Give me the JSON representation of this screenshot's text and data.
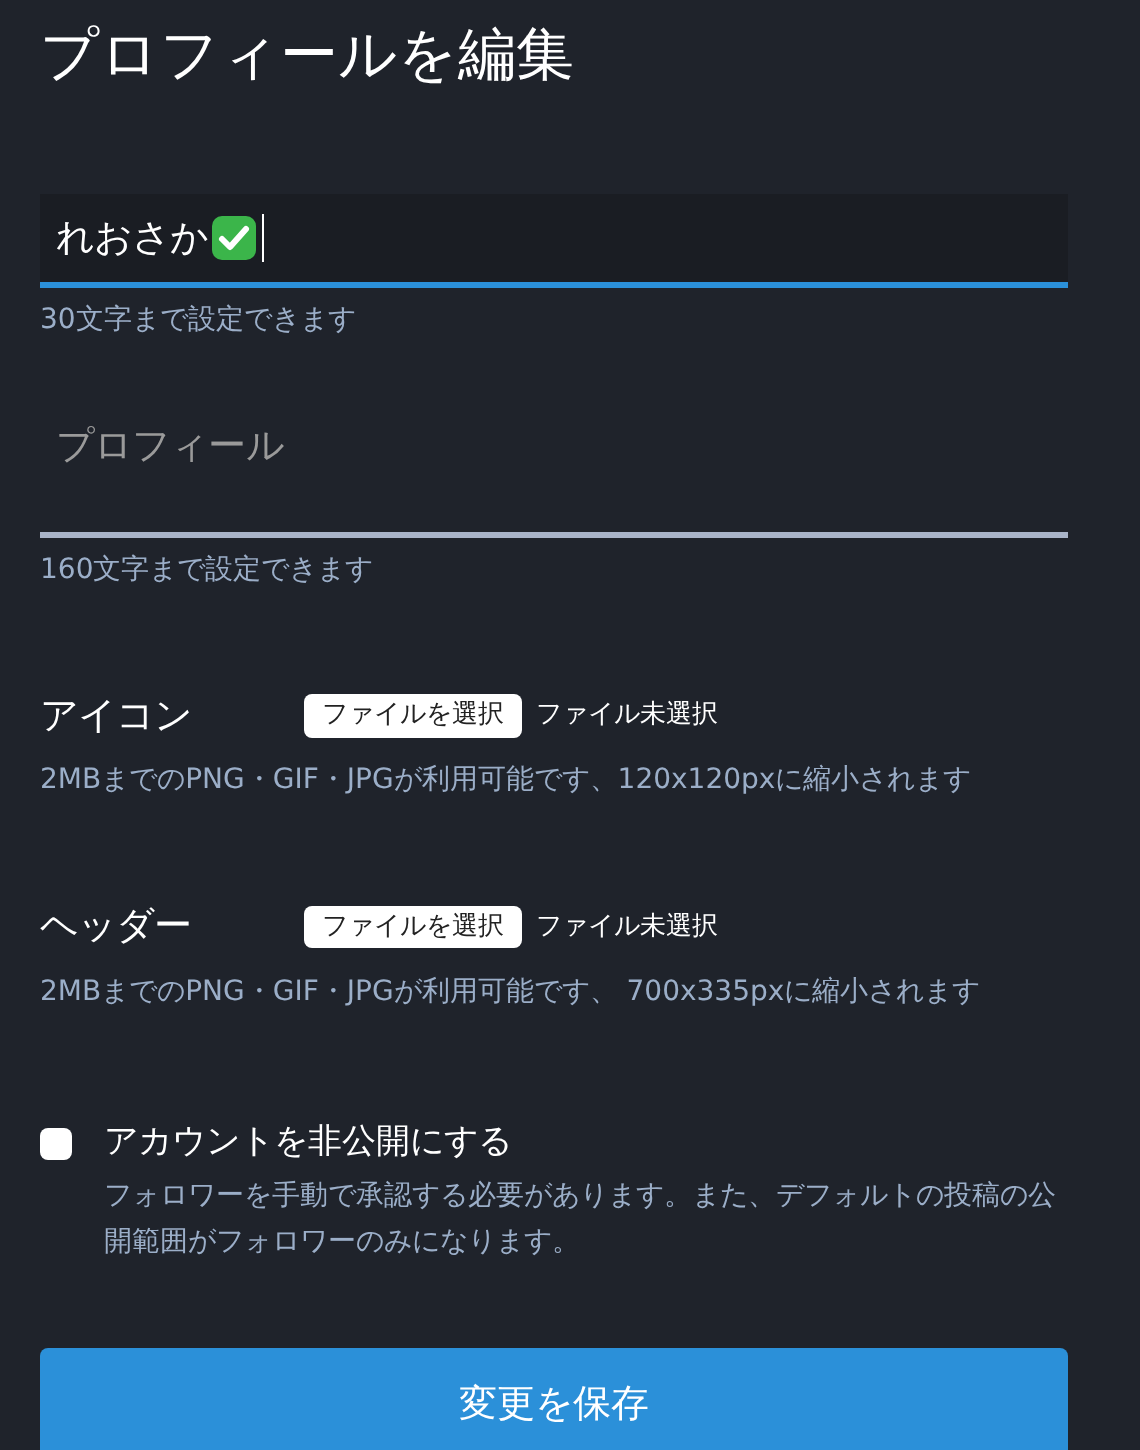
{
  "title": "プロフィールを編集",
  "name_field": {
    "value": "れおさか",
    "focused": true,
    "hint": "30文字まで設定できます"
  },
  "bio_field": {
    "placeholder": "プロフィール",
    "hint": "160文字まで設定できます"
  },
  "uploads": [
    {
      "label": "アイコン",
      "button": "ファイルを選択",
      "status": "ファイル未選択",
      "hint": "2MBまでのPNG・GIF・JPGが利用可能です、120x120pxに縮小されます"
    },
    {
      "label": "ヘッダー",
      "button": "ファイルを選択",
      "status": "ファイル未選択",
      "hint": "2MBまでのPNG・GIF・JPGが利用可能です、 700x335pxに縮小されます"
    }
  ],
  "private_account": {
    "label": "アカウントを非公開にする",
    "checked": false,
    "hint": "フォロワーを手動で承認する必要があります。また、デフォルトの投稿の公開範囲がフォロワーのみになります。"
  },
  "save_button": "変更を保存"
}
